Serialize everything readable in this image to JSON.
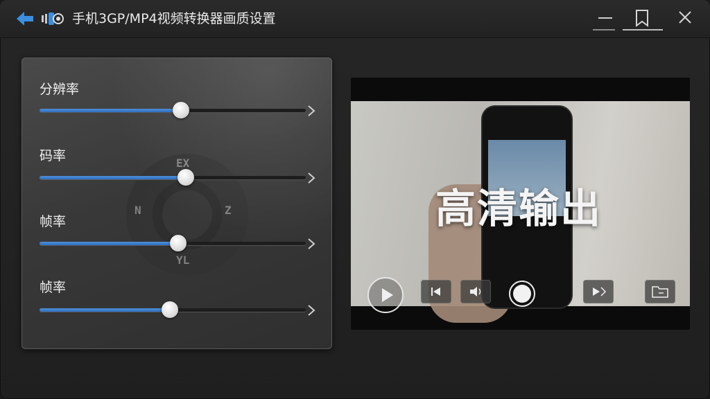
{
  "window": {
    "title": "手机3GP/MP4视频转换器画质设置"
  },
  "icons": {
    "back": "back-arrow-icon",
    "app": "video-camera-icon",
    "minimize": "minimize-icon",
    "bookmark": "bookmark-icon",
    "close": "close-icon"
  },
  "colors": {
    "accent": "#3b7fd0",
    "background": "#222222"
  },
  "settings": {
    "sliders": [
      {
        "label": "分辨率",
        "value": 0.53
      },
      {
        "label": "码率",
        "value": 0.55
      },
      {
        "label": "帧率",
        "value": 0.52
      },
      {
        "label": "帧率",
        "value": 0.49
      }
    ],
    "dial_marks": [
      "EX",
      "N",
      "Z",
      "YL"
    ]
  },
  "preview": {
    "overlay_text": "高清输出",
    "controls": [
      "play-icon",
      "skip-back-icon",
      "volume-icon",
      "shutter-icon",
      "skip-forward-icon",
      "folder-icon"
    ]
  }
}
